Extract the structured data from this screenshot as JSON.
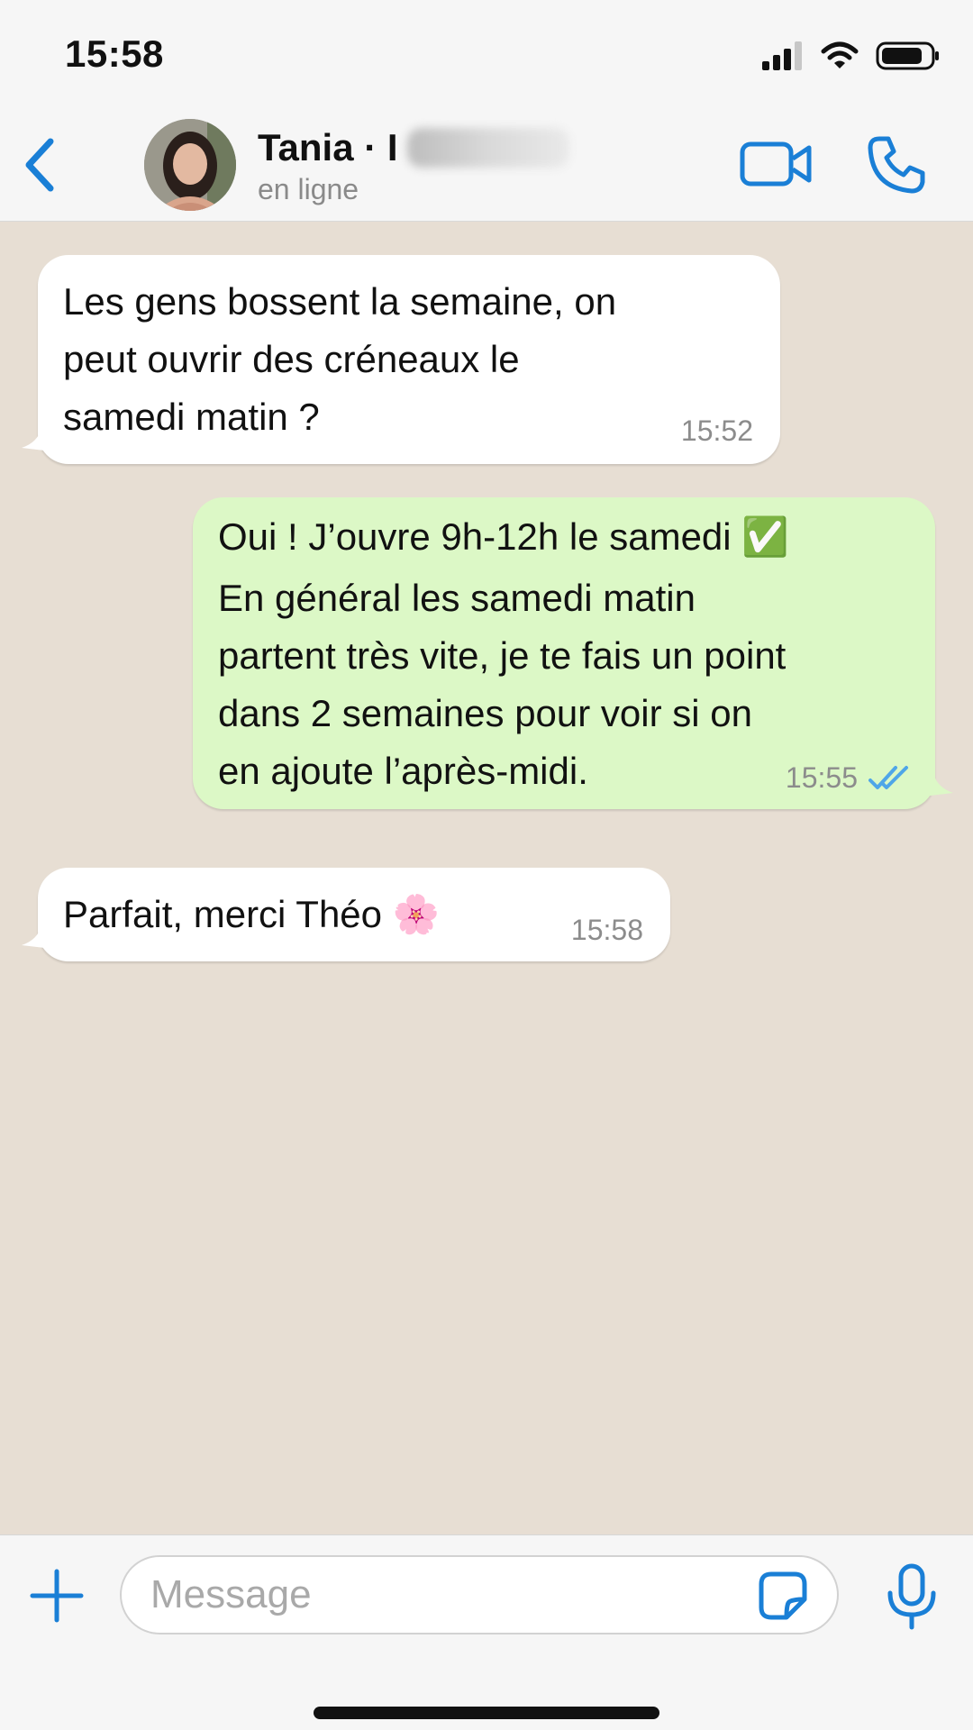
{
  "status_bar": {
    "time": "15:58"
  },
  "header": {
    "contact_name": "Tania · I",
    "contact_status": "en ligne"
  },
  "messages": [
    {
      "direction": "incoming",
      "lines": [
        "Les gens bossent la semaine, on",
        "peut ouvrir des créneaux le",
        "samedi matin ?"
      ],
      "time": "15:52"
    },
    {
      "direction": "outgoing",
      "lines": [
        "Oui ! J’ouvre 9h-12h le samedi ✅",
        "En général les samedi matin",
        "partent très vite, je te fais un point",
        "dans 2 semaines pour voir si on",
        "en ajoute l’après-midi."
      ],
      "time": "15:55",
      "status": "read"
    },
    {
      "direction": "incoming",
      "lines": [
        "Parfait, merci Théo 🌸"
      ],
      "time": "15:58"
    }
  ],
  "composer": {
    "placeholder": "Message",
    "value": ""
  },
  "icons": {
    "back": "chevron-left-icon",
    "video": "video-camera-icon",
    "call": "phone-icon",
    "add": "plus-icon",
    "sticker": "sticker-icon",
    "mic": "microphone-icon"
  },
  "colors": {
    "accent": "#1a7fd6",
    "incoming_bubble": "#ffffff",
    "outgoing_bubble": "#dcf8c6",
    "chat_background": "#e7ded3",
    "read_ticks": "#4fa6e8"
  }
}
